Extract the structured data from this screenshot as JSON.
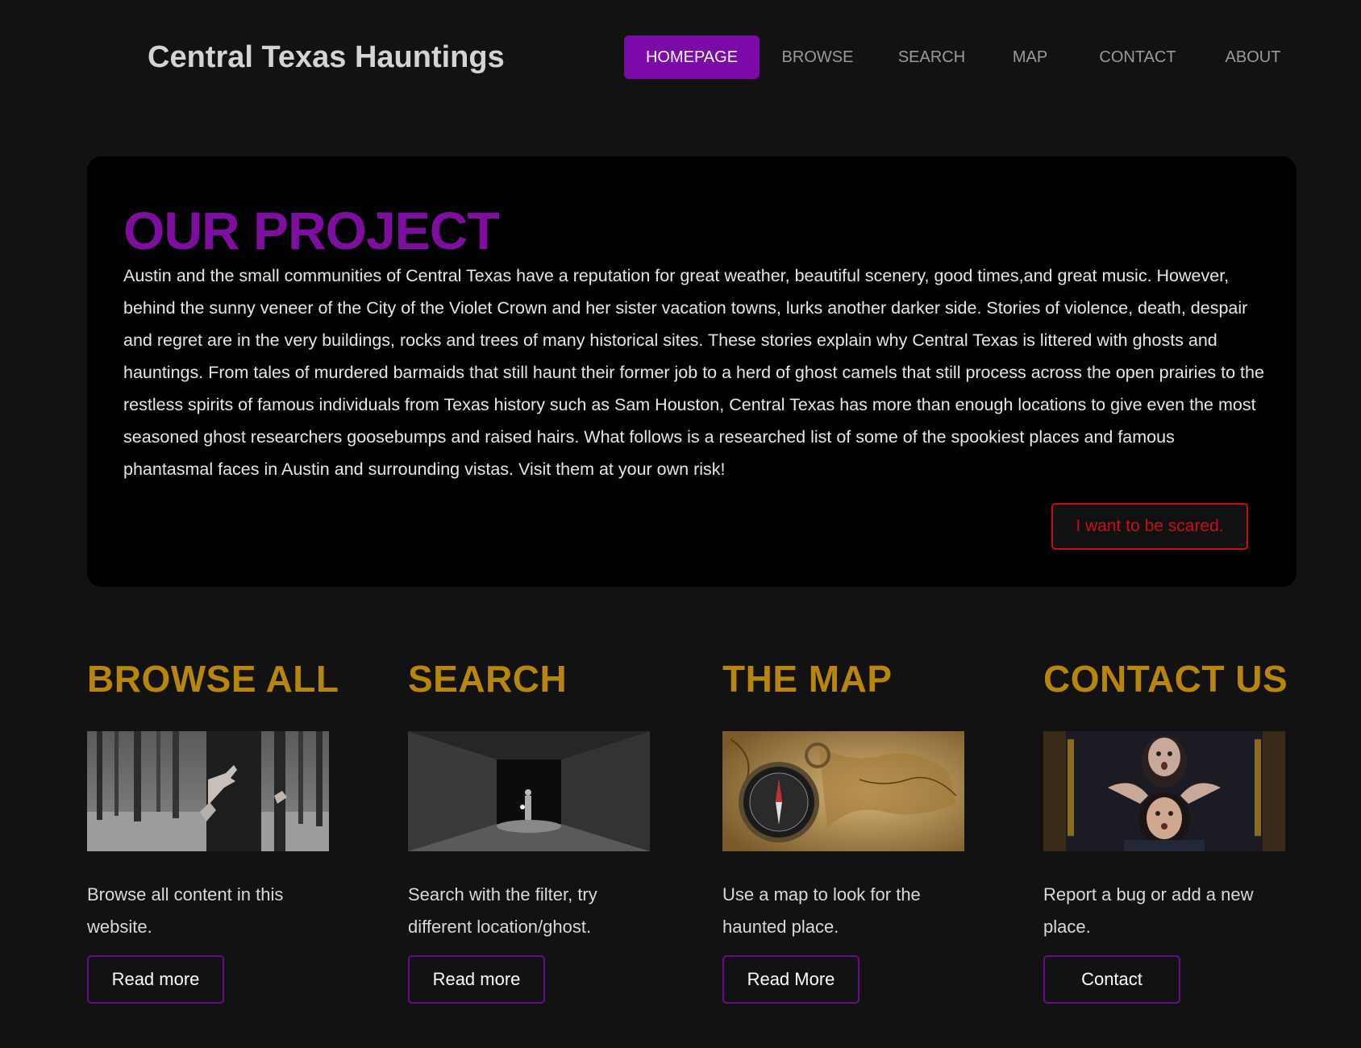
{
  "header": {
    "site_title": "Central Texas Hauntings",
    "nav": [
      {
        "label": "HOMEPAGE",
        "active": true
      },
      {
        "label": "BROWSE",
        "active": false
      },
      {
        "label": "SEARCH",
        "active": false
      },
      {
        "label": "MAP",
        "active": false
      },
      {
        "label": "CONTACT",
        "active": false
      },
      {
        "label": "ABOUT",
        "active": false
      }
    ]
  },
  "project": {
    "title": "OUR PROJECT",
    "text": "Austin and the small communities of Central Texas have a reputation for great weather, beautiful scenery, good times,and great music. However, behind the sunny veneer of the City of the Violet Crown and her sister vacation towns, lurks another darker side. Stories of violence, death, despair and regret are in the very buildings, rocks and trees of many historical sites. These stories explain why Central Texas is littered with ghosts and hauntings. From tales of murdered barmaids that still haunt their former job to a herd of ghost camels that still process across the open prairies to the restless spirits of famous individuals from Texas history such as Sam Houston, Central Texas has more than enough locations to give even the most seasoned ghost researchers goosebumps and raised hairs. What follows is a researched list of some of the spookiest places and famous phantasmal faces in Austin and surrounding vistas. Visit them at your own risk!",
    "button_label": "I want to be scared."
  },
  "cards": [
    {
      "title": "BROWSE ALL",
      "image": "forest-hands-image",
      "description": "Browse all content in this website.",
      "button_label": "Read more"
    },
    {
      "title": "SEARCH",
      "image": "dark-tunnel-image",
      "description": "Search with the filter, try different location/ghost.",
      "button_label": "Read more"
    },
    {
      "title": "THE MAP",
      "image": "compass-map-image",
      "description": "Use a map to look for the haunted place.",
      "button_label": "Read More"
    },
    {
      "title": "CONTACT US",
      "image": "scared-faces-image",
      "description": "Report a bug or add a new place.",
      "button_label": "Contact"
    }
  ],
  "colors": {
    "background": "#121212",
    "accent_purple": "#7c0aa8",
    "gold": "#b8860b",
    "scare_red": "#c40f19"
  }
}
